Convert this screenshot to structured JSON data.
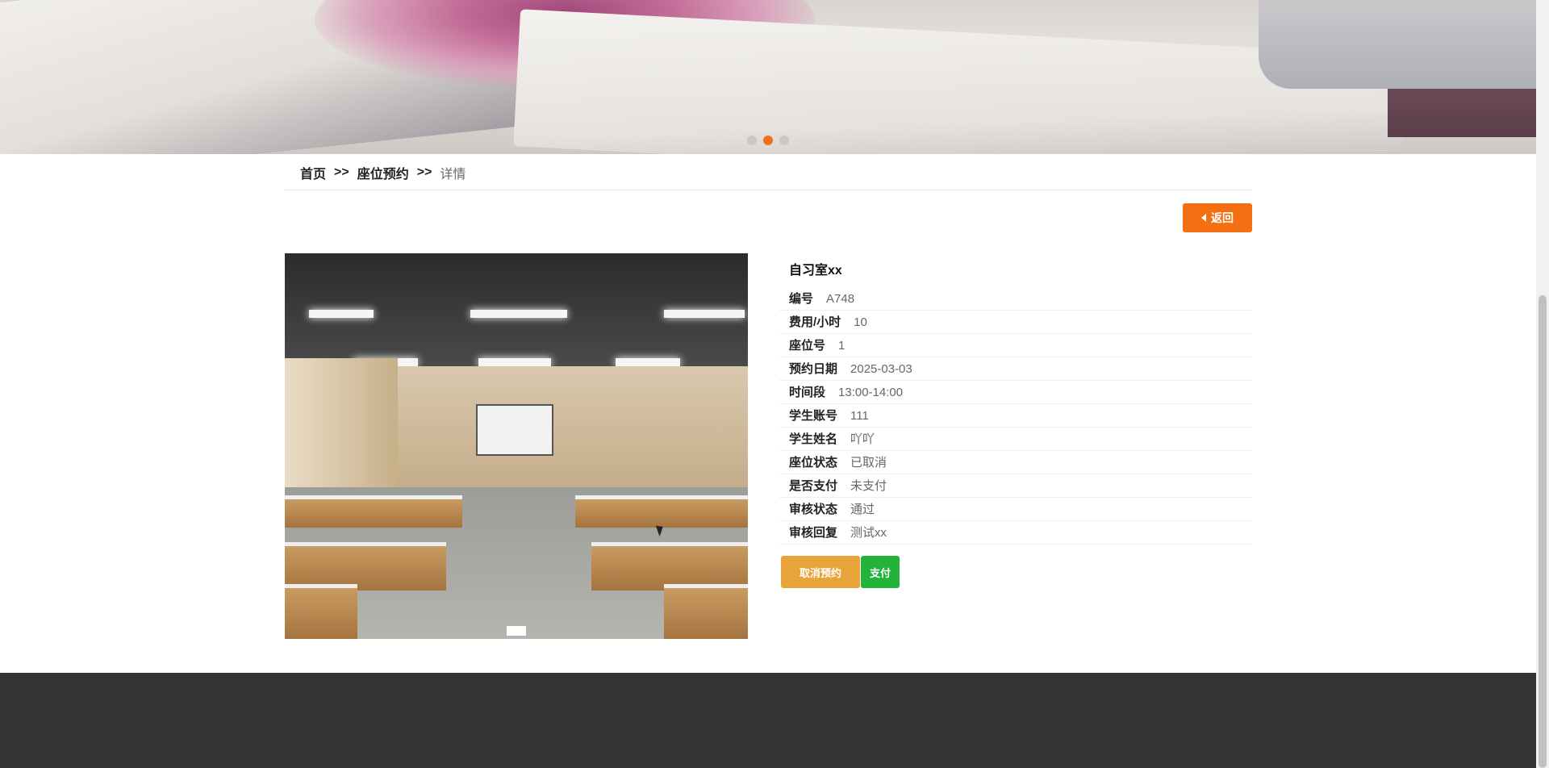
{
  "banner": {
    "slides": 3,
    "active_slide": 2
  },
  "breadcrumb": {
    "home": "首页",
    "separator": ">>",
    "section": "座位预约",
    "current": "详情"
  },
  "back_button": {
    "label": "返回",
    "icon": "caret-left-icon"
  },
  "detail": {
    "title": "自习室xx",
    "fields": [
      {
        "label": "编号",
        "value": "A748"
      },
      {
        "label": "费用/小时",
        "value": "10"
      },
      {
        "label": "座位号",
        "value": "1"
      },
      {
        "label": "预约日期",
        "value": "2025-03-03"
      },
      {
        "label": "时间段",
        "value": "13:00-14:00"
      },
      {
        "label": "学生账号",
        "value": "111"
      },
      {
        "label": "学生姓名",
        "value": "吖吖"
      },
      {
        "label": "座位状态",
        "value": "已取消"
      },
      {
        "label": "是否支付",
        "value": "未支付"
      },
      {
        "label": "审核状态",
        "value": "通过"
      },
      {
        "label": "审核回复",
        "value": "测试xx"
      }
    ]
  },
  "actions": {
    "cancel_label": "取消预约",
    "pay_label": "支付"
  },
  "colors": {
    "accent": "#f26f12",
    "cancel": "#e8a33a",
    "pay": "#22b43a",
    "footer": "#333333"
  }
}
